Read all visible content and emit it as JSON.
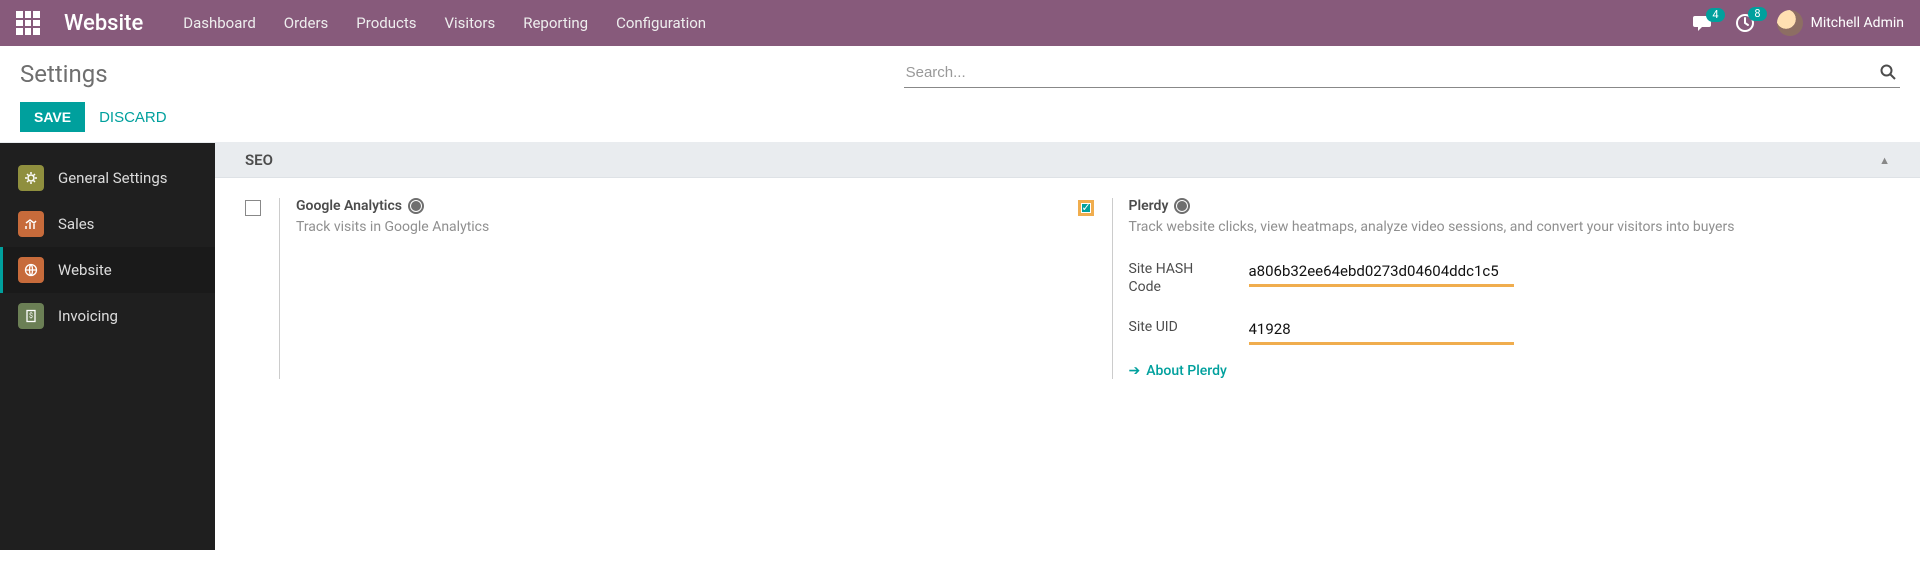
{
  "navbar": {
    "app": "Website",
    "items": [
      "Dashboard",
      "Orders",
      "Products",
      "Visitors",
      "Reporting",
      "Configuration"
    ],
    "messages_badge": "4",
    "activities_badge": "8",
    "user": "Mitchell Admin"
  },
  "control_panel": {
    "breadcrumb": "Settings",
    "search_placeholder": "Search...",
    "save": "SAVE",
    "discard": "DISCARD"
  },
  "sidebar": {
    "items": [
      {
        "label": "General Settings"
      },
      {
        "label": "Sales"
      },
      {
        "label": "Website"
      },
      {
        "label": "Invoicing"
      }
    ],
    "active_index": 2
  },
  "section": {
    "title": "SEO"
  },
  "settings": {
    "ga": {
      "enabled": false,
      "title": "Google Analytics",
      "desc": "Track visits in Google Analytics"
    },
    "plerdy": {
      "enabled": true,
      "title": "Plerdy",
      "desc": "Track website clicks, view heatmaps, analyze video sessions, and convert your visitors into buyers",
      "hash_label": "Site HASH Code",
      "hash_value": "a806b32ee64ebd0273d04604ddc1c5",
      "uid_label": "Site UID",
      "uid_value": "41928",
      "about": "About Plerdy"
    }
  }
}
